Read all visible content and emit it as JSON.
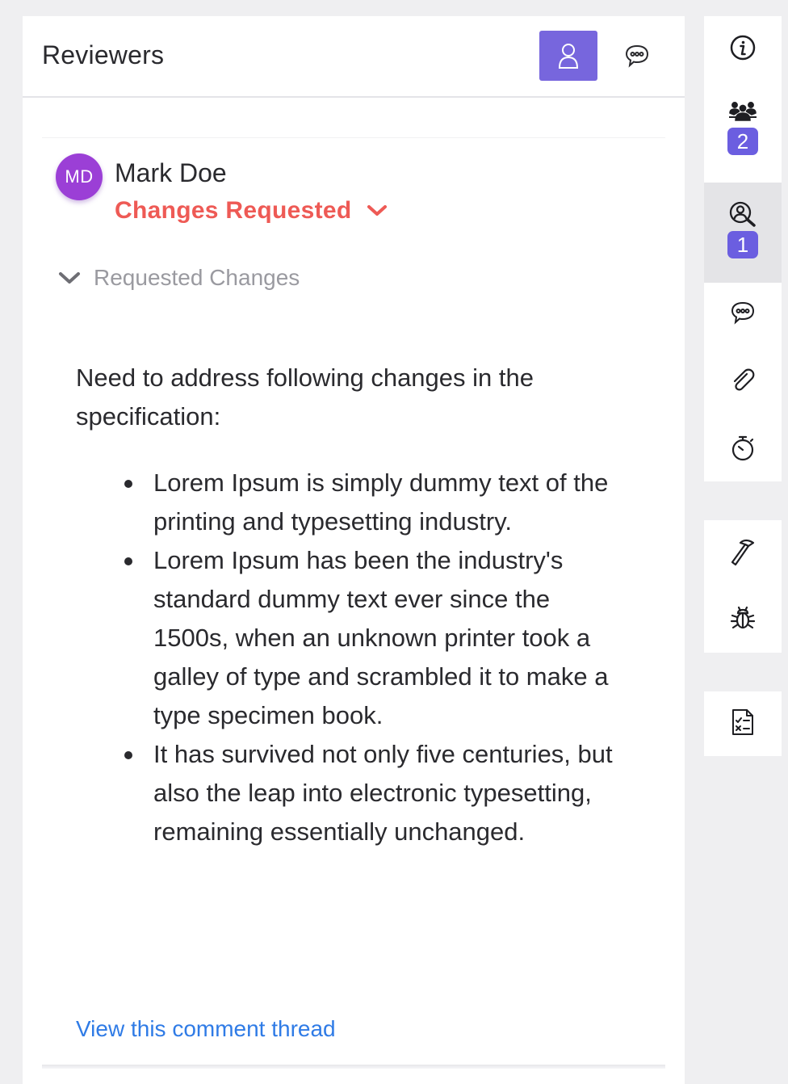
{
  "panel": {
    "title": "Reviewers",
    "header_buttons": {
      "reviewers_icon": "person-icon",
      "comments_icon": "chat-bubble-icon"
    }
  },
  "review": {
    "avatar_initials": "MD",
    "reviewer_name": "Mark Doe",
    "status": "Changes Requested",
    "status_color": "#ee5a55",
    "section_label": "Requested Changes",
    "intro": "Need to address following changes in the specification:",
    "items": [
      "Lorem Ipsum is simply dummy text of the printing and typesetting industry.",
      "Lorem Ipsum has been the industry's standard dummy text ever since the 1500s, when an unknown printer took a galley of type and scrambled it to make a type specimen book.",
      "It has survived not only five centuries, but also the leap into electronic typesetting, remaining essentially unchanged."
    ],
    "thread_link": "View this comment thread"
  },
  "sidebar": {
    "items": [
      {
        "icon": "info-icon"
      },
      {
        "icon": "team-icon",
        "badge": "2"
      },
      {
        "icon": "reviewer-search-icon",
        "badge": "1",
        "active": true
      },
      {
        "icon": "chat-bubble-icon"
      },
      {
        "icon": "paperclip-icon"
      },
      {
        "icon": "stopwatch-icon"
      },
      {
        "icon": "hammer-icon"
      },
      {
        "icon": "bug-icon"
      },
      {
        "icon": "checklist-icon"
      }
    ]
  },
  "colors": {
    "accent": "#7766dd",
    "badge": "#6b5ee0",
    "link": "#2f7be6",
    "avatar": "#9b3fd6"
  }
}
